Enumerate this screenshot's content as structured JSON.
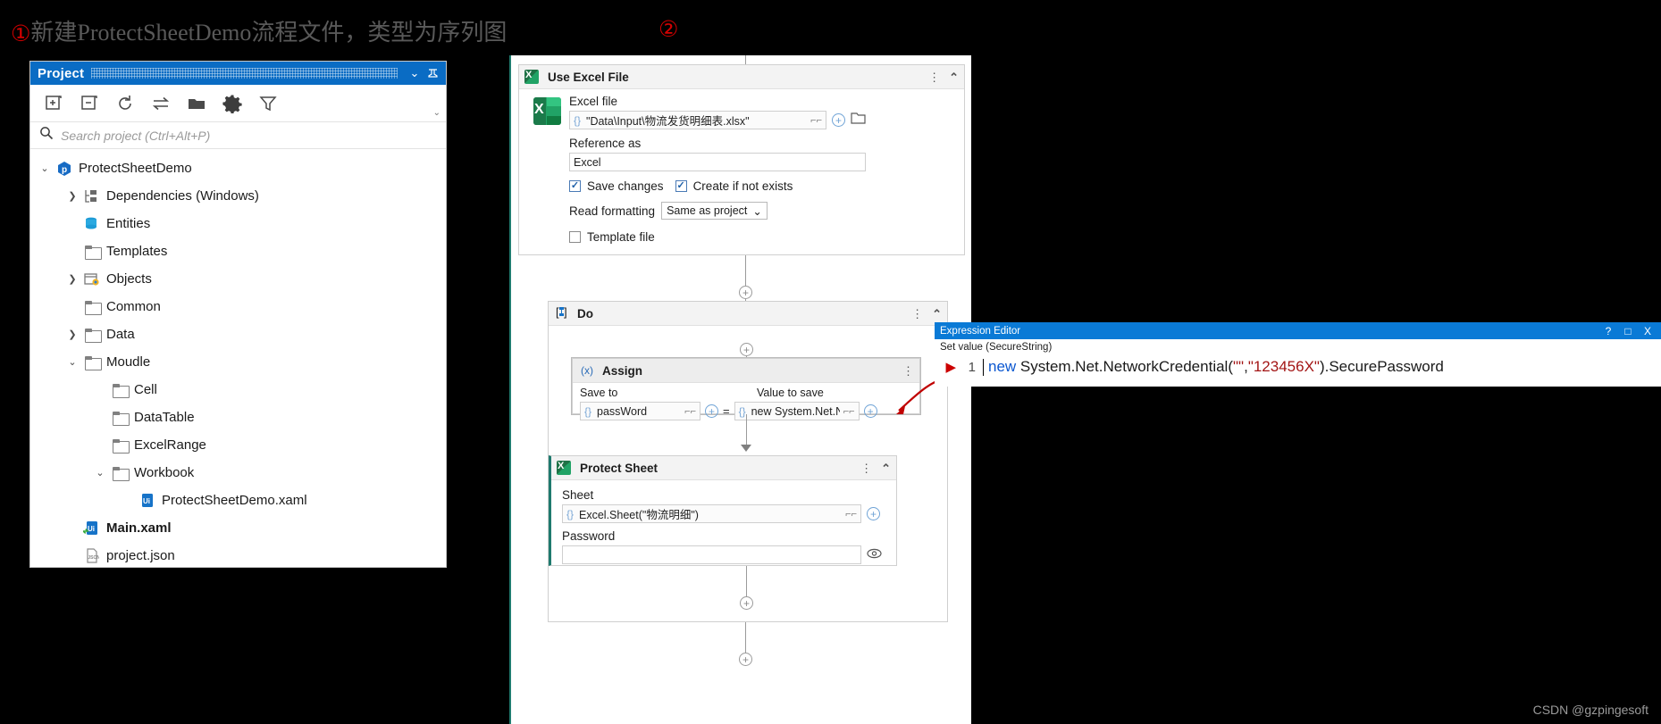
{
  "annotation": {
    "marker1": "①",
    "text1": "新建ProtectSheetDemo流程文件，类型为序列图",
    "marker2": "②"
  },
  "project_panel": {
    "title": "Project",
    "collapse_icon": "chevron-down",
    "pin_icon": "pin",
    "toolbar": [
      {
        "name": "expand-all-icon",
        "label": "Expand all"
      },
      {
        "name": "collapse-all-icon",
        "label": "Collapse all"
      },
      {
        "name": "refresh-icon",
        "label": "Refresh"
      },
      {
        "name": "sync-icon",
        "label": "Show all files"
      },
      {
        "name": "open-folder-icon",
        "label": "Open folder"
      },
      {
        "name": "settings-gear-icon",
        "label": "Settings"
      },
      {
        "name": "filter-icon",
        "label": "Filter"
      }
    ],
    "search": {
      "placeholder": "Search project (Ctrl+Alt+P)",
      "value": ""
    },
    "tree": [
      {
        "label": "ProtectSheetDemo",
        "icon": "uipath-project-icon",
        "depth": 0,
        "chevron": "down",
        "bold": false
      },
      {
        "label": "Dependencies (Windows)",
        "icon": "dependencies-icon",
        "depth": 1,
        "chevron": "right",
        "bold": false
      },
      {
        "label": "Entities",
        "icon": "entities-icon",
        "depth": 1,
        "chevron": "none",
        "bold": false
      },
      {
        "label": "Templates",
        "icon": "folder-icon",
        "depth": 1,
        "chevron": "none",
        "bold": false
      },
      {
        "label": "Objects",
        "icon": "objects-icon",
        "depth": 1,
        "chevron": "right",
        "bold": false
      },
      {
        "label": "Common",
        "icon": "folder-icon",
        "depth": 1,
        "chevron": "none",
        "bold": false
      },
      {
        "label": "Data",
        "icon": "folder-icon",
        "depth": 1,
        "chevron": "right",
        "bold": false
      },
      {
        "label": "Moudle",
        "icon": "folder-icon",
        "depth": 1,
        "chevron": "down",
        "bold": false
      },
      {
        "label": "Cell",
        "icon": "folder-icon",
        "depth": 2,
        "chevron": "none",
        "bold": false
      },
      {
        "label": "DataTable",
        "icon": "folder-icon",
        "depth": 2,
        "chevron": "none",
        "bold": false
      },
      {
        "label": "ExcelRange",
        "icon": "folder-icon",
        "depth": 2,
        "chevron": "none",
        "bold": false
      },
      {
        "label": "Workbook",
        "icon": "folder-icon",
        "depth": 2,
        "chevron": "down",
        "bold": false
      },
      {
        "label": "ProtectSheetDemo.xaml",
        "icon": "xaml-file-icon",
        "depth": 3,
        "chevron": "none",
        "bold": false
      },
      {
        "label": "Main.xaml",
        "icon": "xaml-main-file-icon",
        "depth": 1,
        "chevron": "none",
        "bold": true
      },
      {
        "label": "project.json",
        "icon": "json-file-icon",
        "depth": 1,
        "chevron": "none",
        "bold": false
      }
    ]
  },
  "designer": {
    "use_excel_file": {
      "title": "Use Excel File",
      "icon": "excel-icon",
      "excel_file_label": "Excel file",
      "excel_file_value": "\"Data\\Input\\物流发货明细表.xlsx\"",
      "reference_as_label": "Reference as",
      "reference_as_value": "Excel",
      "save_changes_label": "Save changes",
      "save_changes_checked": true,
      "create_if_not_exists_label": "Create if not exists",
      "create_if_not_exists_checked": true,
      "read_formatting_label": "Read formatting",
      "read_formatting_value": "Same as project",
      "template_file_label": "Template file",
      "template_file_checked": false
    },
    "do_block": {
      "title": "Do",
      "icon": "sequence-icon"
    },
    "assign": {
      "title": "Assign",
      "icon": "assign-variable-icon",
      "save_to_label": "Save to",
      "save_to_value": "passWord",
      "equals": "=",
      "value_to_save_label": "Value to save",
      "value_to_save_value": "new System.Net.Net"
    },
    "protect_sheet": {
      "title": "Protect Sheet",
      "icon": "excel-icon",
      "sheet_label": "Sheet",
      "sheet_value": "Excel.Sheet(\"物流明细\")",
      "password_label": "Password",
      "password_value": "",
      "reveal_icon": "eye-icon"
    },
    "add_icon": "plus-circle-icon"
  },
  "expression_editor": {
    "title": "Expression Editor",
    "help_btn": "?",
    "maximize_btn": "□",
    "close_btn": "X",
    "subtitle": "Set value (SecureString)",
    "line_number": "1",
    "code_keyword": "new",
    "code_rest_1": " System.Net.NetworkCredential(",
    "code_str_1": "\"\"",
    "code_comma": ",",
    "code_str_2": "\"123456X\"",
    "code_rest_2": ").SecurePassword",
    "full_code": "new System.Net.NetworkCredential(\"\",\"123456X\").SecurePassword"
  },
  "watermark": "CSDN @gzpingesoft",
  "colors": {
    "title_blue": "#0a6cc4",
    "dialog_blue": "#0a7ad6",
    "excel_green": "#21a366",
    "accent_red": "#d40000",
    "designer_rail": "#1f7a6e"
  }
}
